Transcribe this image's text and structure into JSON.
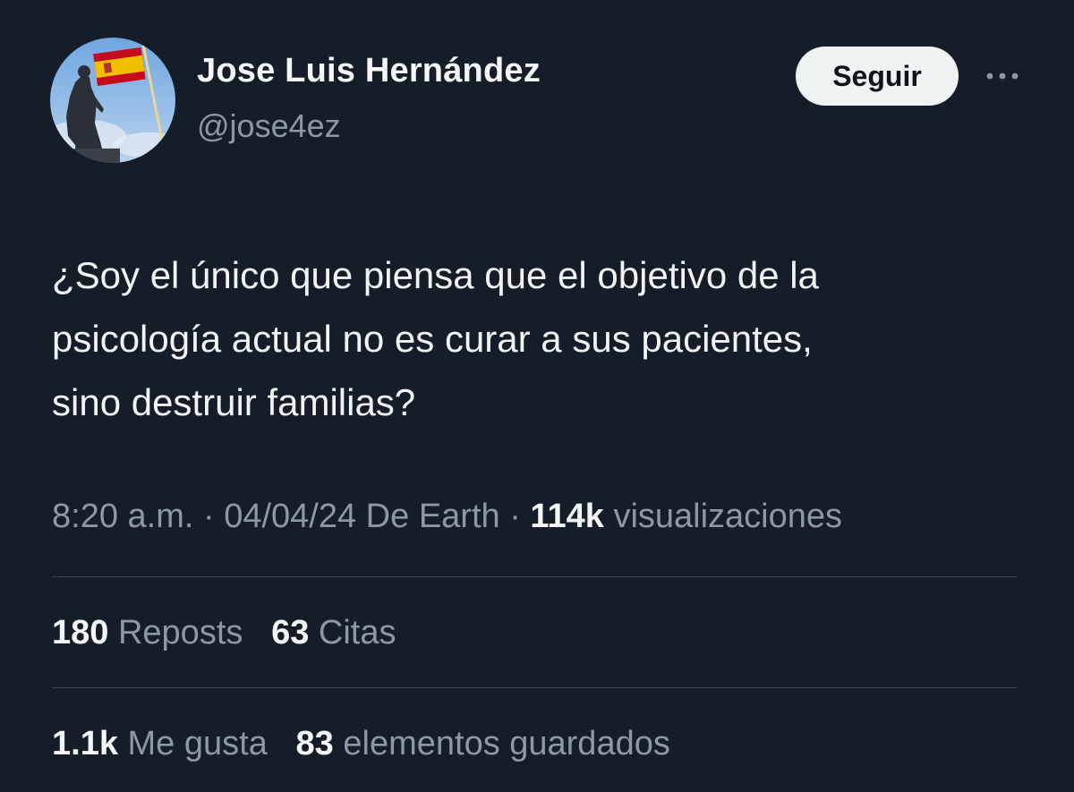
{
  "user": {
    "display_name": "Jose Luis Hernández",
    "handle": "@jose4ez",
    "avatar_icon": "avatar-statue-with-spanish-flag"
  },
  "actions": {
    "follow_label": "Seguir",
    "more_icon": "more-dots-icon"
  },
  "tweet": {
    "text": "¿Soy el único que piensa que el objetivo de la\npsicología actual no es curar a sus pacientes,\nsino destruir familias?"
  },
  "meta": {
    "time": "8:20 a.m.",
    "sep1": "·",
    "date_source": "04/04/24 De Earth",
    "sep2": "·",
    "views_count": "114k",
    "views_label": "visualizaciones"
  },
  "stats_row1": {
    "reposts_count": "180",
    "reposts_label": "Reposts",
    "quotes_count": "63",
    "quotes_label": "Citas"
  },
  "stats_row2": {
    "likes_count": "1.1k",
    "likes_label": "Me gusta",
    "bookmarks_count": "83",
    "bookmarks_label": "elementos guardados"
  },
  "colors": {
    "background": "#151d28",
    "primary_text": "#f4f6f7",
    "secondary_text": "#8b98a5",
    "divider": "#38444d",
    "button_bg": "#eff3f4"
  }
}
